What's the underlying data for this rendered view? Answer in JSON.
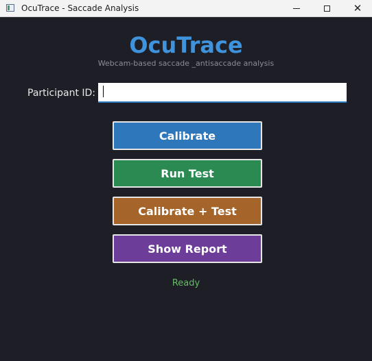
{
  "window": {
    "title": "OcuTrace - Saccade Analysis",
    "icon": "app-window-icon",
    "controls": {
      "minimize_icon": "minimize-icon",
      "maximize_icon": "maximize-icon",
      "close_icon": "close-icon",
      "close_glyph": "✕"
    }
  },
  "header": {
    "title": "OcuTrace",
    "subtitle": "Webcam-based saccade _antisaccade analysis"
  },
  "form": {
    "participant_label": "Participant ID:",
    "participant_value": "",
    "participant_placeholder": ""
  },
  "actions": {
    "calibrate": "Calibrate",
    "run_test": "Run Test",
    "calibrate_test": "Calibrate + Test",
    "show_report": "Show Report"
  },
  "status": {
    "text": "Ready"
  },
  "colors": {
    "background": "#1e1f26",
    "title": "#3f93dd",
    "calibrate": "#2f77bb",
    "run_test": "#2a8a52",
    "calibrate_test": "#a5652a",
    "show_report": "#6c3d99",
    "status": "#66bb66"
  }
}
